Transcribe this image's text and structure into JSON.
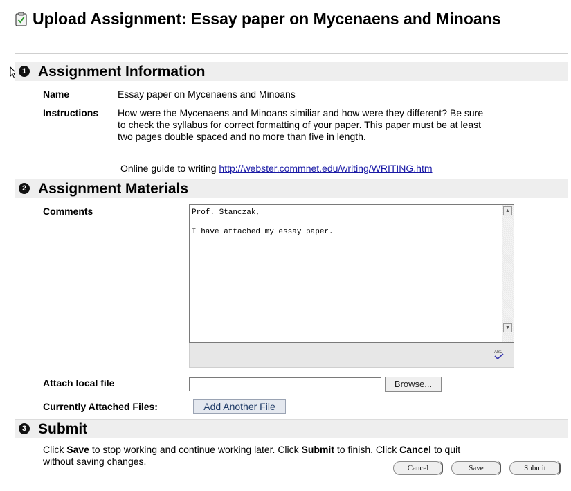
{
  "page": {
    "title": "Upload Assignment: Essay paper on Mycenaens and Minoans",
    "title_icon": "clipboard-check-icon"
  },
  "sections": {
    "info": {
      "number": "1",
      "title": "Assignment Information",
      "name_label": "Name",
      "name_value": "Essay paper on Mycenaens and Minoans",
      "instructions_label": "Instructions",
      "instructions_line1": "How were the Mycenaens and Minoans similiar and how were they different? Be sure",
      "instructions_line2": "to check the syllabus for correct formatting of your paper. This paper must be at least",
      "instructions_line3": "two pages double spaced and no more than five in length.",
      "guide_text": "Online guide to writing",
      "guide_link": "http://webster.commnet.edu/writing/WRITING.htm"
    },
    "materials": {
      "number": "2",
      "title": "Assignment Materials",
      "comments_label": "Comments",
      "comments_value": "Prof. Stanczak,\n\nI have attached my essay paper.",
      "attach_label": "Attach local file",
      "attach_value": "",
      "browse_label": "Browse...",
      "attached_files_label": "Currently Attached Files:",
      "add_file_label": "Add Another File"
    },
    "submit": {
      "number": "3",
      "title": "Submit",
      "line1_a": "Click ",
      "save_word": "Save",
      "line1_b": " to stop working and continue working later. Click ",
      "submit_word": "Submit",
      "line1_c": " to finish. Click ",
      "cancel_word": "Cancel",
      "line1_d": " to quit",
      "line2": "without saving changes.",
      "cancel_button": "Cancel",
      "save_button": "Save",
      "submit_button": "Submit"
    }
  },
  "colors": {
    "section_bar": "#eeeeee",
    "link": "#1a1aa6"
  }
}
